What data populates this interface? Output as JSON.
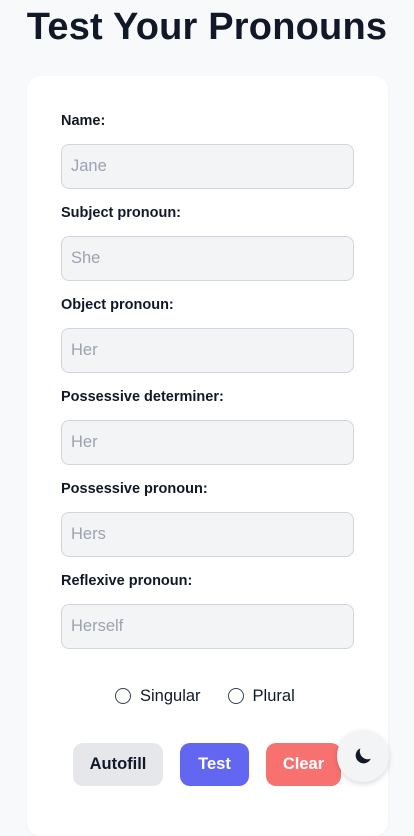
{
  "title": "Test Your Pronouns",
  "fields": [
    {
      "label": "Name:",
      "placeholder": "Jane"
    },
    {
      "label": "Subject pronoun:",
      "placeholder": "She"
    },
    {
      "label": "Object pronoun:",
      "placeholder": "Her"
    },
    {
      "label": "Possessive determiner:",
      "placeholder": "Her"
    },
    {
      "label": "Possessive pronoun:",
      "placeholder": "Hers"
    },
    {
      "label": "Reflexive pronoun:",
      "placeholder": "Herself"
    }
  ],
  "number": {
    "options": [
      "Singular",
      "Plural"
    ]
  },
  "buttons": {
    "autofill": "Autofill",
    "test": "Test",
    "clear": "Clear"
  },
  "theme_toggle": {
    "icon": "moon-icon"
  },
  "colors": {
    "primary": "#6366f1",
    "danger": "#f87171",
    "neutral": "#e5e7eb"
  }
}
